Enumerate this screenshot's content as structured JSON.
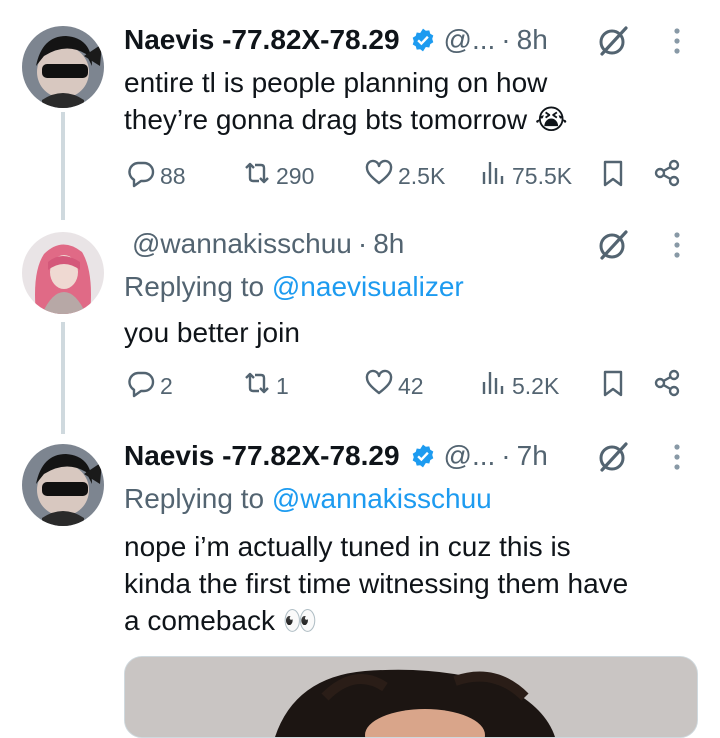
{
  "tweets": [
    {
      "name": "Naevis -77.82X-78.29",
      "handle": "@...",
      "sep": "·",
      "time": "8h",
      "text_line1": "entire tl is people planning on how",
      "text_line2": "they’re gonna drag bts tomorrow 😭",
      "replies": "88",
      "retweets": "290",
      "likes": "2.5K",
      "views": "75.5K"
    },
    {
      "handle": "@wannakisschuu",
      "sep": "·",
      "time": "8h",
      "replying_prefix": "Replying to",
      "replying_handle": "@naevisualizer",
      "text": "you better join",
      "replies": "2",
      "retweets": "1",
      "likes": "42",
      "views": "5.2K"
    },
    {
      "name": "Naevis -77.82X-78.29",
      "handle": "@...",
      "sep": "·",
      "time": "7h",
      "replying_prefix": "Replying to",
      "replying_handle": "@wannakisschuu",
      "text_line1": "nope i’m actually tuned in cuz this is",
      "text_line2": "kinda the first time witnessing them have",
      "text_line3": "a comeback 👀"
    }
  ],
  "icons": [
    "grok-icon",
    "more-icon",
    "reply-icon",
    "retweet-icon",
    "like-icon",
    "views-icon",
    "bookmark-icon",
    "share-icon",
    "verified-icon"
  ],
  "colors": {
    "link": "#1d9bf0",
    "muted": "#536471",
    "verified": "#1d9bf0",
    "line": "#cfd9de"
  }
}
